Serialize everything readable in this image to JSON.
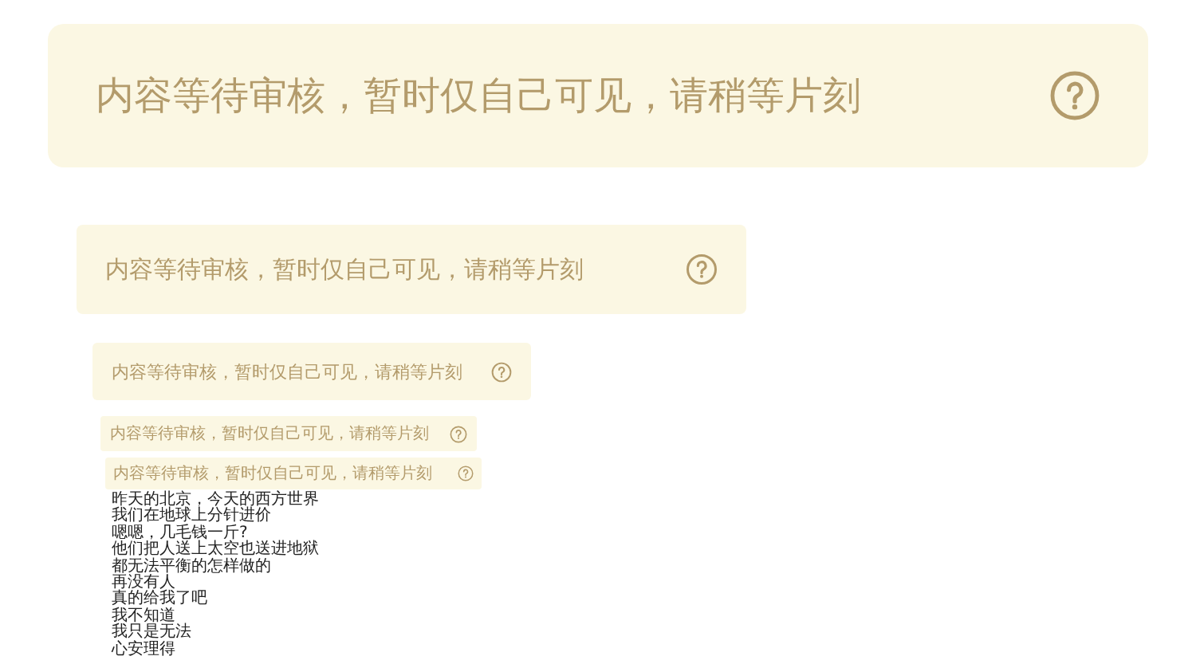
{
  "banners": [
    {
      "text": "内容等待审核，暂时仅自己可见，请稍等片刻",
      "kind": "xl"
    },
    {
      "text": "内容等待审核，暂时仅自己可见，请稍等片刻",
      "kind": "lg"
    },
    {
      "text": "内容等待审核，暂时仅自己可见，请稍等片刻",
      "kind": "md"
    },
    {
      "text": "内容等待审核，暂时仅自己可见，请稍等片刻",
      "kind": "sm"
    },
    {
      "text": "内容等待审核，暂时仅自己可见，请稍等片刻",
      "kind": "xs"
    }
  ],
  "lines": [
    "昨天的北京，今天的西方世界",
    "我们在地球上分针进价",
    "嗯嗯，几毛钱一斤?",
    "他们把人送上太空也送进地狱",
    "都无法平衡的怎样做的",
    "再没有人",
    "真的给我了吧",
    "我不知道",
    "我只是无法",
    "心安理得"
  ]
}
